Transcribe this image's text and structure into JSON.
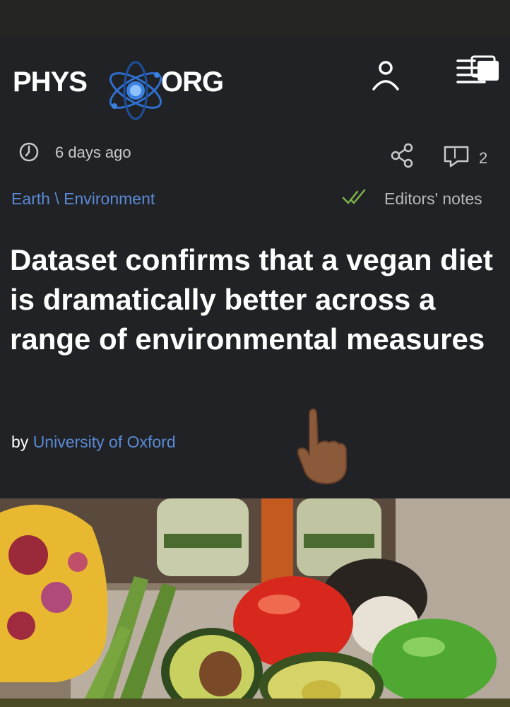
{
  "header": {
    "logo_left": "PHYS",
    "logo_right": "ORG"
  },
  "meta": {
    "time_ago": "6 days ago",
    "comment_count": "2"
  },
  "category": "Earth \\ Environment",
  "editors_notes": "Editors' notes",
  "article": {
    "title": "Dataset confirms that a vegan diet is dramatically better across a range of environmental measures",
    "by": "by",
    "author": "University of Oxford"
  },
  "colors": {
    "background": "#202226",
    "link": "#5b8ad4",
    "check": "#7fb24a"
  },
  "icons": [
    "atom-logo-icon",
    "user-icon",
    "menu-icon",
    "clock-icon",
    "share-icon",
    "comment-icon",
    "double-check-icon",
    "pointing-hand-icon"
  ]
}
